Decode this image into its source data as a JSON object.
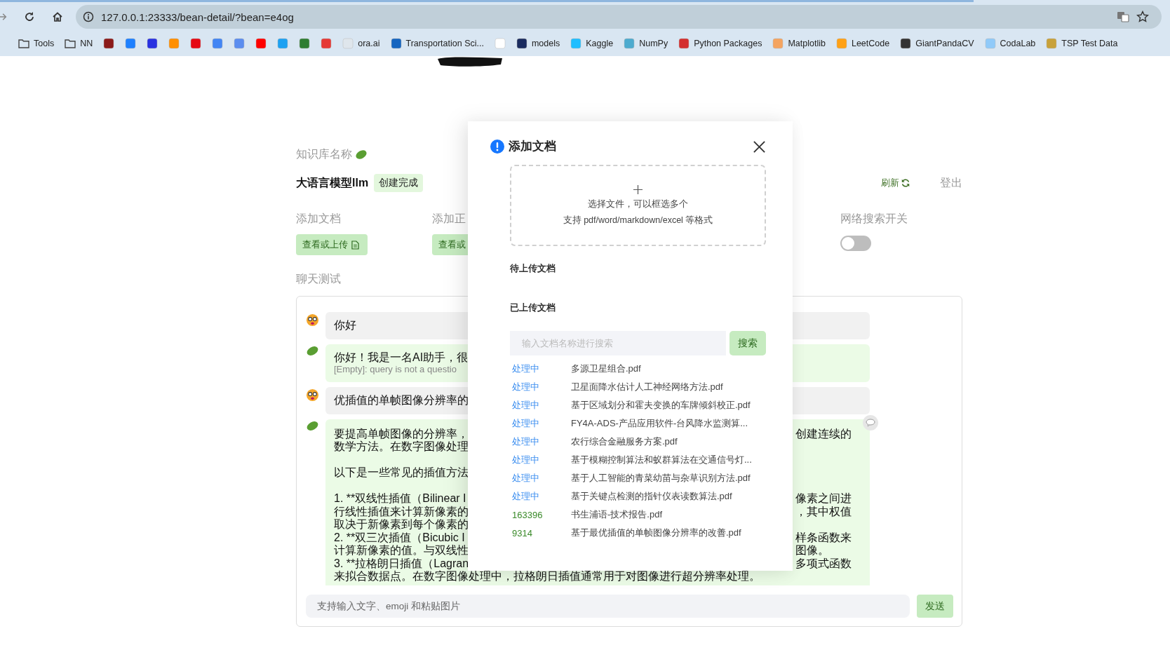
{
  "browser": {
    "url": "127.0.0.1:23333/bean-detail/?bean=e4og",
    "bookmarks": [
      {
        "kind": "folder",
        "label": "Tools"
      },
      {
        "kind": "folder",
        "label": "NN"
      },
      {
        "kind": "site",
        "color": "#8b1a1a"
      },
      {
        "kind": "site",
        "color": "#1e80ff"
      },
      {
        "kind": "site",
        "color": "#2932e1"
      },
      {
        "kind": "site",
        "color": "#ff8f00"
      },
      {
        "kind": "site",
        "color": "#e50914"
      },
      {
        "kind": "site",
        "color": "#4285f4"
      },
      {
        "kind": "site",
        "color": "#5b8def"
      },
      {
        "kind": "site",
        "color": "#ff0000"
      },
      {
        "kind": "site",
        "color": "#1da1f2"
      },
      {
        "kind": "site",
        "color": "#2e7d32"
      },
      {
        "kind": "site",
        "color": "#e53935"
      },
      {
        "kind": "site",
        "color": "#dfe6ec",
        "label": "ora.ai"
      },
      {
        "kind": "site",
        "color": "#1565c0",
        "label": "Transportation Sci..."
      },
      {
        "kind": "site",
        "color": "#ffffff"
      },
      {
        "kind": "site",
        "color": "#1a2b5f",
        "label": "models"
      },
      {
        "kind": "site",
        "color": "#20beff",
        "label": "Kaggle"
      },
      {
        "kind": "site",
        "color": "#4dabcf",
        "label": "NumPy"
      },
      {
        "kind": "site",
        "color": "#d32f2f",
        "label": "Python Packages"
      },
      {
        "kind": "site",
        "color": "#f4a460",
        "label": "Matplotlib"
      },
      {
        "kind": "site",
        "color": "#ffa116",
        "label": "LeetCode"
      },
      {
        "kind": "site",
        "color": "#333333",
        "label": "GiantPandaCV"
      },
      {
        "kind": "site",
        "color": "#90caf9",
        "label": "CodaLab"
      },
      {
        "kind": "site",
        "color": "#c8a13a",
        "label": "TSP Test Data"
      }
    ]
  },
  "page": {
    "kb_label": "知识库名称",
    "kb_name": "大语言模型llm",
    "status_tag": "创建完成",
    "refresh": "刷新",
    "logout": "登出",
    "sections": [
      {
        "label": "添加文档",
        "button": "查看或上传",
        "kind": "upload"
      },
      {
        "label": "添加正",
        "button": "查看或",
        "kind": "plain"
      }
    ],
    "web_search": {
      "label": "网络搜索开关",
      "on": false
    },
    "chat_label": "聊天测试",
    "messages": [
      {
        "kind": "user",
        "lines": [
          {
            "kind": "text",
            "left": "你好"
          }
        ]
      },
      {
        "kind": "bot",
        "lines": [
          {
            "kind": "text",
            "left": "你好！我是一名AI助手，很"
          }
        ],
        "note": "[Empty]: query is not a questio"
      },
      {
        "kind": "user",
        "lines": [
          {
            "kind": "text",
            "left": "优插值的单帧图像分辨率的"
          }
        ]
      },
      {
        "kind": "bot",
        "comment": true,
        "lines": [
          {
            "kind": "text",
            "left": "要提高单帧图像的分辨率，",
            "right": "创建连续的"
          },
          {
            "kind": "text",
            "left": "数学方法。在数字图像处理"
          },
          {
            "kind": "gap"
          },
          {
            "kind": "text",
            "left": "以下是一些常见的插值方法"
          },
          {
            "kind": "gap"
          },
          {
            "kind": "text",
            "left": "1. **双线性插值（Bilinear I",
            "right": "像素之间进"
          },
          {
            "kind": "text",
            "left": "行线性插值来计算新像素的",
            "right": "，其中权值"
          },
          {
            "kind": "text",
            "left": "取决于新像素到每个像素的"
          },
          {
            "kind": "text",
            "left": "2. **双三次插值（Bicubic I",
            "right": "样条函数来"
          },
          {
            "kind": "text",
            "left": "计算新像素的值。与双线性",
            "right": "图像。"
          },
          {
            "kind": "text",
            "left": "3. **拉格朗日插值（Lagran",
            "right": "多项式函数"
          },
          {
            "kind": "full",
            "left": "来拟合数据点。在数字图像处理中，拉格朗日插值通常用于对图像进行超分辨率处理。"
          }
        ]
      }
    ],
    "input_placeholder": "支持输入文字、emoji 和粘贴图片",
    "send": "发送"
  },
  "dialog": {
    "title": "添加文档",
    "drop_line1": "选择文件，可以框选多个",
    "drop_line2": "支持 pdf/word/markdown/excel 等格式",
    "pending_label": "待上传文档",
    "uploaded_label": "已上传文档",
    "search_placeholder": "输入文档名称进行搜索",
    "search_button": "搜索",
    "files": [
      {
        "kind": "processing",
        "status": "处理中",
        "name": "多源卫星组合.pdf"
      },
      {
        "kind": "processing",
        "status": "处理中",
        "name": "卫星面降水估计人工神经网络方法.pdf"
      },
      {
        "kind": "processing",
        "status": "处理中",
        "name": "基于区域划分和霍夫变换的车牌倾斜校正.pdf"
      },
      {
        "kind": "processing",
        "status": "处理中",
        "name": "FY4A-ADS-产品应用软件-台风降水监测算..."
      },
      {
        "kind": "processing",
        "status": "处理中",
        "name": "农行综合金融服务方案.pdf"
      },
      {
        "kind": "processing",
        "status": "处理中",
        "name": "基于模糊控制算法和蚁群算法在交通信号灯..."
      },
      {
        "kind": "processing",
        "status": "处理中",
        "name": "基于人工智能的青菜幼苗与杂草识别方法.pdf"
      },
      {
        "kind": "processing",
        "status": "处理中",
        "name": "基于关键点检测的指针仪表读数算法.pdf"
      },
      {
        "kind": "done",
        "status": "163396",
        "name": "书生浦语-技术报告.pdf"
      },
      {
        "kind": "done",
        "status": "9314",
        "name": "基于最优插值的单帧图像分辨率的改善.pdf"
      }
    ]
  }
}
